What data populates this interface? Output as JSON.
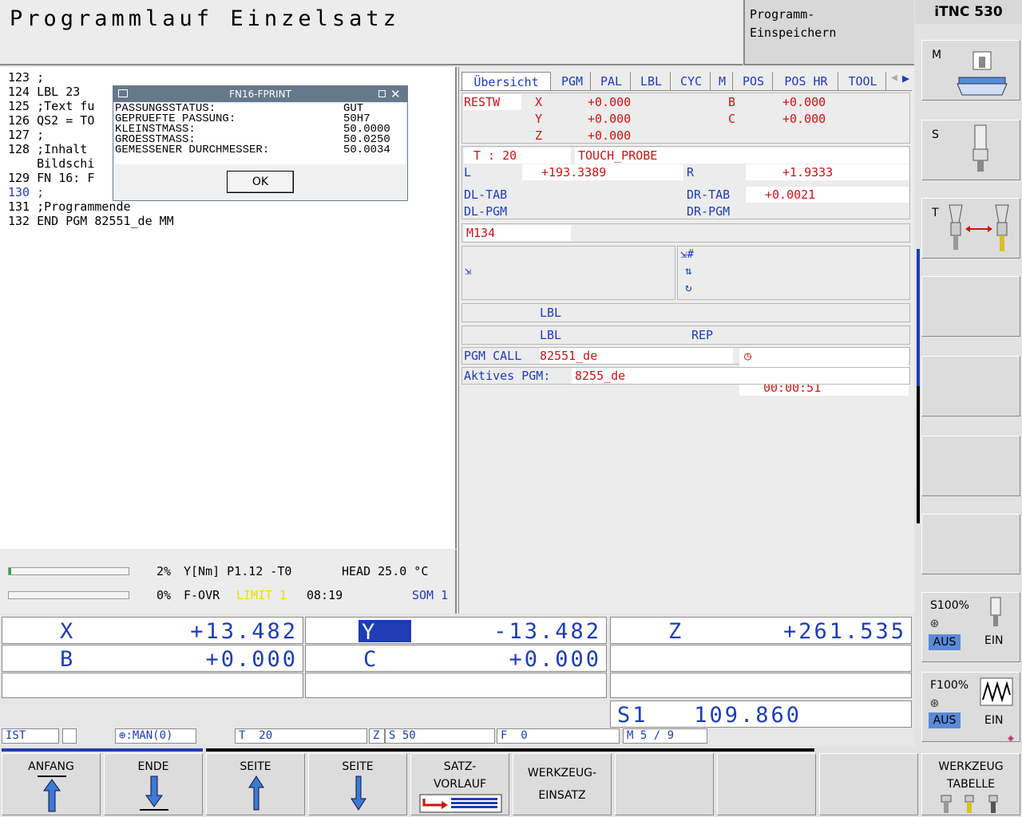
{
  "header": {
    "title": "Programmlauf Einzelsatz",
    "mode_line1": "Programm-",
    "mode_line2": "Einspeichern",
    "logo": "iTNC 530"
  },
  "program": {
    "lines": [
      "123 ;",
      "124 LBL 23",
      "125 ;Text fu",
      "126 QS2 = TO",
      "127 ;",
      "128 ;Inhalt",
      "    Bildschi",
      "129 FN 16: F",
      "130 ;",
      "131 ;Programmende",
      "132 END PGM 82551_de MM"
    ],
    "current_index": 8
  },
  "dialog": {
    "title": "FN16-FPRINT",
    "rows": [
      {
        "label": "PASSUNGSSTATUS:",
        "value": "GUT"
      },
      {
        "label": "GEPRUEFTE PASSUNG:",
        "value": "50H7"
      },
      {
        "label": "KLEINSTMASS:",
        "value": "50.0000"
      },
      {
        "label": "GROESSTMASS:",
        "value": "50.0250"
      },
      {
        "label": "GEMESSENER DURCHMESSER:",
        "value": "50.0034"
      }
    ],
    "ok_label": "OK"
  },
  "load": {
    "spindle_pct": "2%",
    "spindle_info": "Y[Nm] P1.12 -T0",
    "head_temp": "HEAD 25.0 °C",
    "feed_pct": "0%",
    "feed_label": "F-OVR",
    "limit_label": "LIMIT 1",
    "time": "08:19",
    "som": "SOM 1",
    "spindle_fill": 0.02,
    "feed_fill": 0.0
  },
  "tabs": [
    "Übersicht",
    "PGM",
    "PAL",
    "LBL",
    "CYC",
    "M",
    "POS",
    "POS HR",
    "TOOL"
  ],
  "overview": {
    "restw_label": "RESTW",
    "restw": [
      {
        "axis": "X",
        "value": "+0.000"
      },
      {
        "axis": "Y",
        "value": "+0.000"
      },
      {
        "axis": "Z",
        "value": "+0.000"
      }
    ],
    "restw_rot": [
      {
        "axis": "B",
        "value": "+0.000"
      },
      {
        "axis": "C",
        "value": "+0.000"
      }
    ],
    "tool_label": "T : 20",
    "tool_name": "TOUCH_PROBE",
    "l_label": "L",
    "l_value": "+193.3389",
    "r_label": "R",
    "r_value": "+1.9333",
    "dltab_label": "DL-TAB",
    "drtab_label": "DR-TAB",
    "drtab_value": "+0.0021",
    "dlpgm_label": "DL-PGM",
    "drpgm_label": "DR-PGM",
    "m_active": "M134",
    "hash_label": "#",
    "lbl1_label": "LBL",
    "lbl2_label": "LBL",
    "rep_label": "REP",
    "pgmcall_label": "PGM CALL",
    "pgmcall_value": "82551_de",
    "runtime": "00:00:51",
    "active_pgm_label": "Aktives PGM:",
    "active_pgm_value": "8255_de"
  },
  "positions": {
    "x": {
      "axis": "X",
      "value": "+13.482"
    },
    "y": {
      "axis": "Y",
      "value": "-13.482"
    },
    "z": {
      "axis": "Z",
      "value": "+261.535"
    },
    "b": {
      "axis": "B",
      "value": "+0.000"
    },
    "c": {
      "axis": "C",
      "value": "+0.000"
    },
    "s1": "S1   109.860"
  },
  "statusbar": {
    "ist": "IST",
    "man": ":MAN(0)",
    "t": "T  20",
    "z": "Z",
    "s": "S 50",
    "f": "F  0",
    "m": "M 5 / 9"
  },
  "right_softkeys": {
    "m": "M",
    "s": "S",
    "t": "T",
    "s100": "S100%",
    "f100": "F100%",
    "aus": "AUS",
    "ein": "EIN"
  },
  "bottom_softkeys": {
    "anfang": "ANFANG",
    "ende": "ENDE",
    "seite_up": "SEITE",
    "seite_down": "SEITE",
    "satz1": "SATZ-",
    "satz2": "VORLAUF",
    "wz_einsatz1": "WERKZEUG-",
    "wz_einsatz2": "EINSATZ",
    "wz_tab1": "WERKZEUG",
    "wz_tab2": "TABELLE"
  },
  "colors": {
    "blue": "#1e3cb4",
    "red": "#c81414",
    "limit_yellow": "#e8e000",
    "gauge_green": "#1fae3a"
  }
}
